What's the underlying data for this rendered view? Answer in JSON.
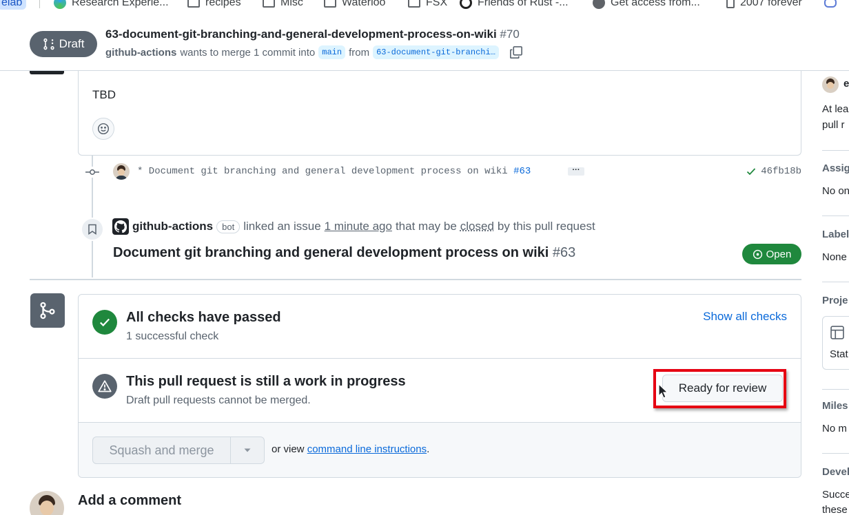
{
  "bookmarks": [
    {
      "label": "elab",
      "icon": "pill"
    },
    {
      "label": "Research Experie...",
      "icon": "edge-icon"
    },
    {
      "label": "recipes",
      "icon": "folder-icon"
    },
    {
      "label": "Misc",
      "icon": "folder-icon"
    },
    {
      "label": "Waterloo",
      "icon": "folder-icon"
    },
    {
      "label": "FSX",
      "icon": "folder-icon"
    },
    {
      "label": "Friends of Rust -...",
      "icon": "rust-icon"
    },
    {
      "label": "Get access from...",
      "icon": "globe-icon"
    },
    {
      "label": "2007 forever",
      "icon": "page-icon"
    }
  ],
  "header": {
    "status_label": "Draft",
    "title": "63-document-git-branching-and-general-development-process-on-wiki",
    "number": "#70",
    "author": "github-actions",
    "merge_text": "wants to merge 1 commit into",
    "base_branch": "main",
    "from_text": "from",
    "head_branch": "63-document-git-branchi…"
  },
  "comment": {
    "body": "TBD"
  },
  "commit": {
    "message": "* Document git branching and general development process on wiki",
    "issue_ref": "#63",
    "ellipsis": "···",
    "sha": "46fb18b"
  },
  "issue_event": {
    "actor": "github-actions",
    "bot_label": "bot",
    "linked_text": "linked an issue",
    "time": "1 minute ago",
    "that_text": "that may be",
    "closed_text": "closed",
    "by_text": "by this pull request",
    "issue_title": "Document git branching and general development process on wiki",
    "issue_number": "#63",
    "issue_status": "Open"
  },
  "merge_box": {
    "checks_title": "All checks have passed",
    "checks_sub": "1 successful check",
    "show_checks": "Show all checks",
    "wip_title": "This pull request is still a work in progress",
    "wip_sub": "Draft pull requests cannot be merged.",
    "ready_button": "Ready for review",
    "merge_button": "Squash and merge",
    "or_view": "or view",
    "cli_link": "command line instructions",
    "period": "."
  },
  "add_comment": {
    "title": "Add a comment"
  },
  "sidebar": {
    "reviewer_initial": "e",
    "reviewer_note_1": "At lea",
    "reviewer_note_2": "pull r",
    "assignees_head": "Assig",
    "assignees_value": "No on",
    "labels_head": "Label",
    "labels_value": "None",
    "projects_head": "Proje",
    "projects_status": "Stat",
    "milestone_head": "Miles",
    "milestone_value": "No m",
    "development_head": "Devel",
    "development_value_1": "Succe",
    "development_value_2": "these"
  },
  "colors": {
    "accent_link": "#0969da",
    "success_green": "#1f883d",
    "draft_gray": "#59636e",
    "highlight_red": "#e60012"
  }
}
